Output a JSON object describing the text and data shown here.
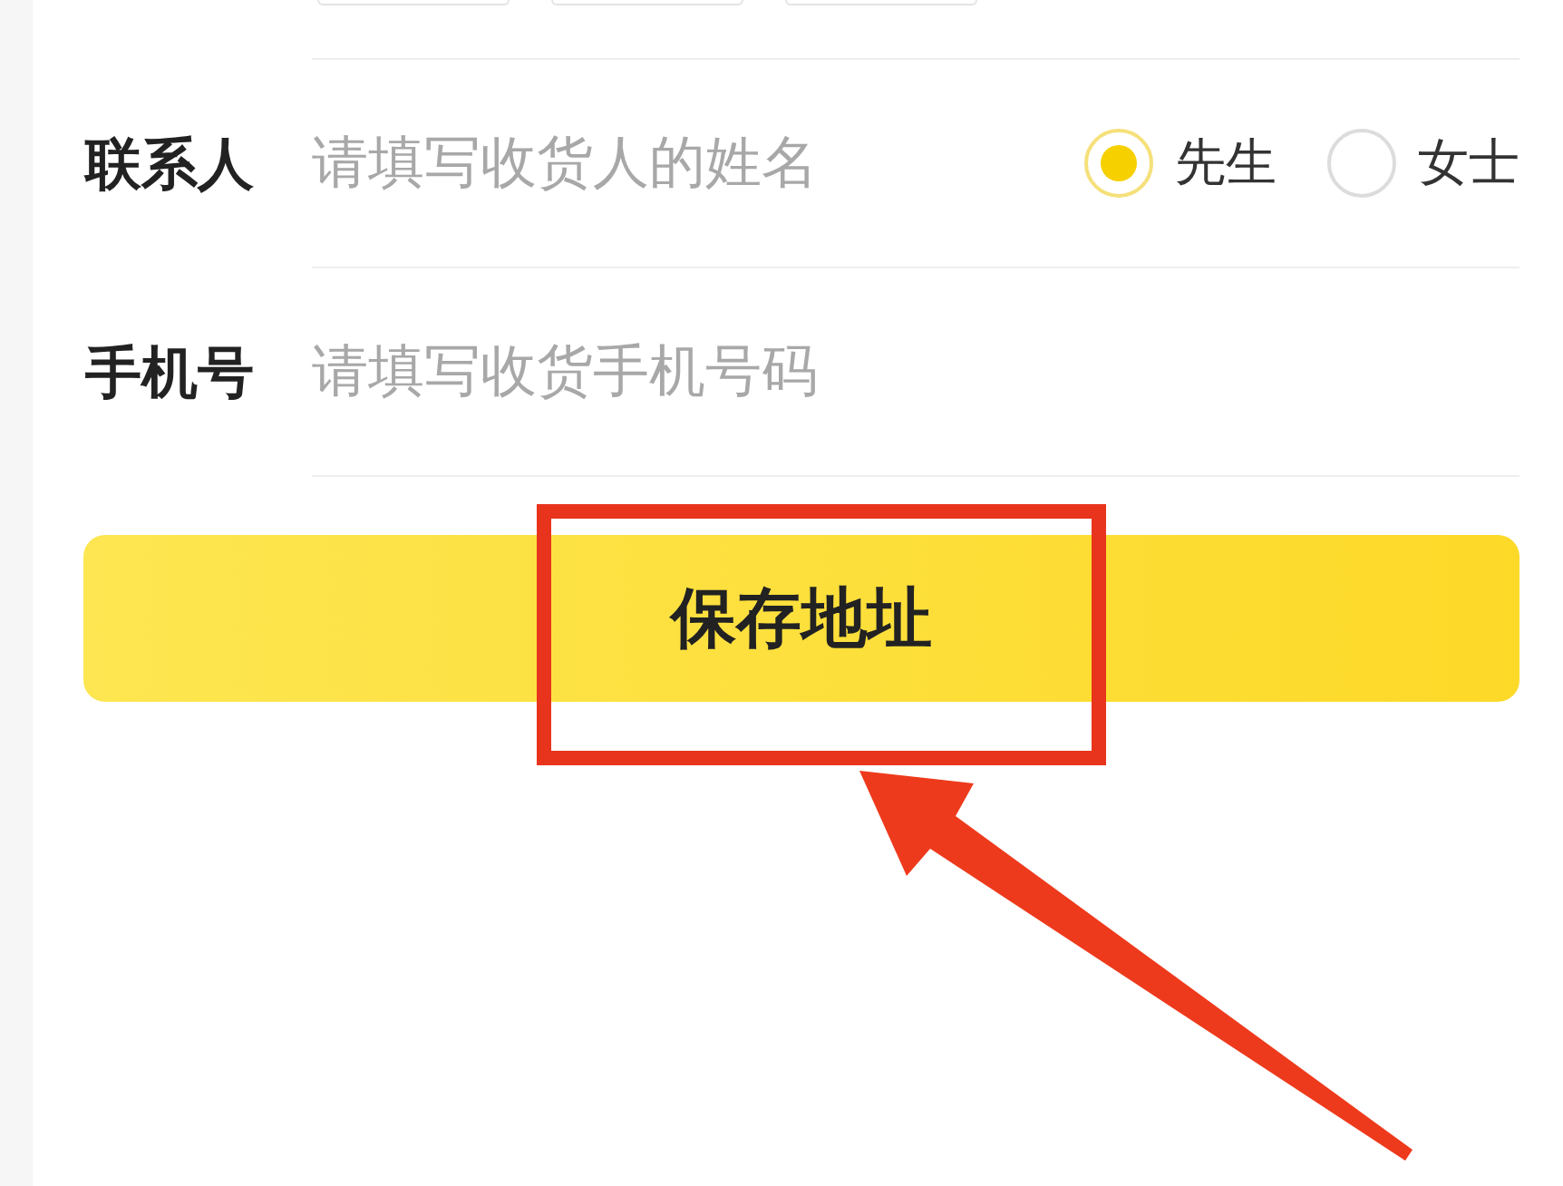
{
  "fields": [
    {
      "label": "联系人",
      "placeholder": "请填写收货人的姓名",
      "options": [
        {
          "label": "先生",
          "selected": true
        },
        {
          "label": "女士",
          "selected": false
        }
      ]
    },
    {
      "label": "手机号",
      "placeholder": "请填写收货手机号码"
    }
  ],
  "save_button": {
    "label": "保存地址"
  }
}
